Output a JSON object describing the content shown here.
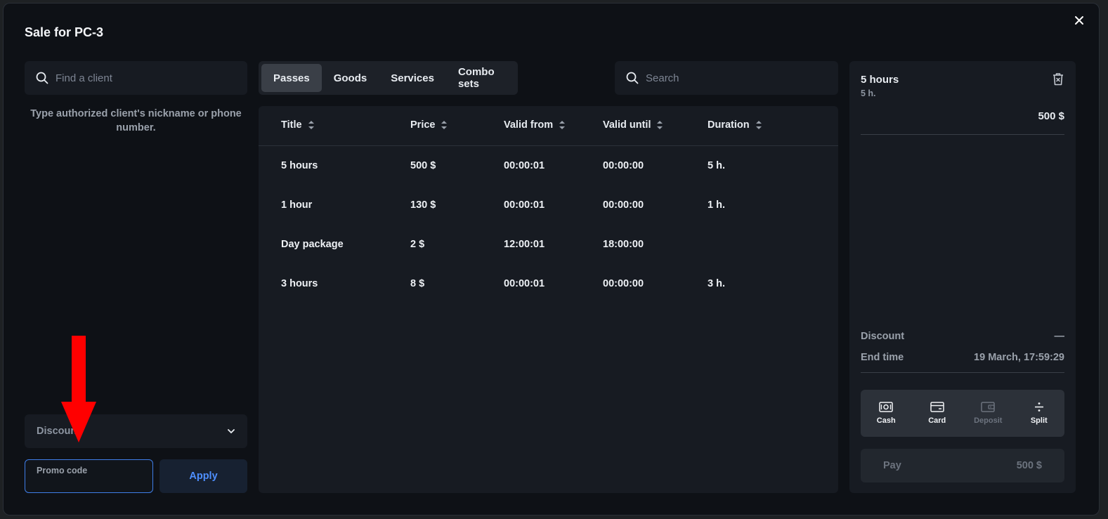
{
  "modal": {
    "title": "Sale for PC-3"
  },
  "client": {
    "search_placeholder": "Find a client",
    "hint": "Type authorized client's nickname or phone number."
  },
  "discount": {
    "label": "Discount"
  },
  "promo": {
    "label": "Promo code",
    "value": "",
    "apply_label": "Apply"
  },
  "tabs": [
    {
      "label": "Passes",
      "active": true
    },
    {
      "label": "Goods"
    },
    {
      "label": "Services"
    },
    {
      "label": "Combo sets"
    }
  ],
  "goods_search": {
    "placeholder": "Search"
  },
  "table": {
    "headers": [
      "Title",
      "Price",
      "Valid from",
      "Valid until",
      "Duration"
    ],
    "rows": [
      [
        "5 hours",
        "500 $",
        "00:00:01",
        "00:00:00",
        "5 h."
      ],
      [
        "1 hour",
        "130 $",
        "00:00:01",
        "00:00:00",
        "1 h."
      ],
      [
        "Day package",
        "2 $",
        "12:00:01",
        "18:00:00",
        ""
      ],
      [
        "3 hours",
        "8 $",
        "00:00:01",
        "00:00:00",
        "3 h."
      ]
    ]
  },
  "cart": {
    "item": {
      "title": "5 hours",
      "subtitle": "5 h.",
      "price": "500 $"
    },
    "discount_label": "Discount",
    "discount_value": "—",
    "end_time_label": "End time",
    "end_time_value": "19 March, 17:59:29",
    "pay_methods": [
      {
        "label": "Cash",
        "icon": "cash-icon"
      },
      {
        "label": "Card",
        "icon": "card-icon"
      },
      {
        "label": "Deposit",
        "icon": "wallet-icon",
        "disabled": true
      },
      {
        "label": "Split",
        "icon": "divide-icon"
      }
    ],
    "pay_label": "Pay",
    "pay_amount": "500 $"
  },
  "colors": {
    "accent": "#4e8fff",
    "annotation_arrow": "#ff0000",
    "background": "#0e1116"
  }
}
